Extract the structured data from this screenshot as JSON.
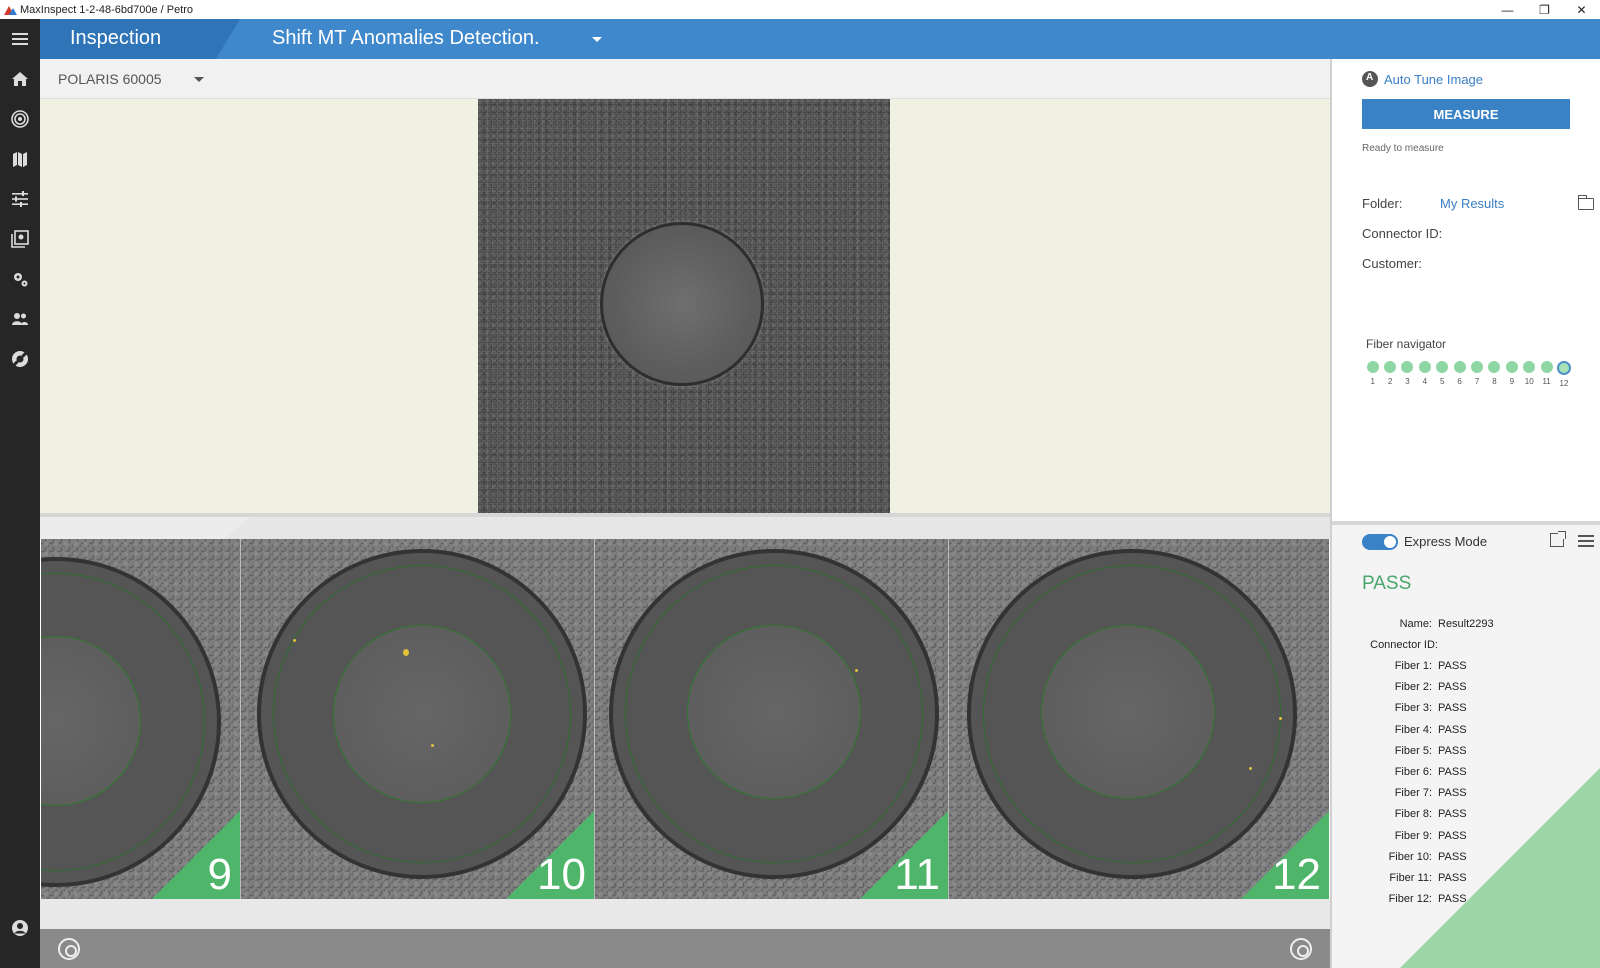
{
  "window": {
    "title": "MaxInspect 1-2-48-6bd700e / Petro",
    "minimize": "—",
    "restore": "❐",
    "close": "✕"
  },
  "header": {
    "section": "Inspection",
    "tool": "Shift MT Anomalies Detection."
  },
  "device": {
    "name": "POLARIS 60005"
  },
  "rail": {
    "icons": [
      "menu-icon",
      "home-icon",
      "target-icon",
      "map-icon",
      "sliders-icon",
      "gallery-icon",
      "settings-icon",
      "users-icon",
      "support-icon",
      "account-icon"
    ]
  },
  "panel": {
    "auto_tune": "Auto Tune Image",
    "measure": "MEASURE",
    "status": "Ready to measure",
    "folder_label": "Folder:",
    "folder_value": "My Results",
    "connector_label": "Connector ID:",
    "customer_label": "Customer:",
    "navigator_title": "Fiber navigator",
    "fibers": [
      "1",
      "2",
      "3",
      "4",
      "5",
      "6",
      "7",
      "8",
      "9",
      "10",
      "11",
      "12"
    ],
    "current_fiber": 12
  },
  "thumbnails": [
    {
      "label": "9"
    },
    {
      "label": "10"
    },
    {
      "label": "11"
    },
    {
      "label": "12"
    }
  ],
  "results": {
    "express_mode": "Express Mode",
    "status": "PASS",
    "name_label": "Name:",
    "name_value": "Result2293",
    "connector_label": "Connector ID:",
    "fibers": [
      {
        "label": "Fiber 1:",
        "value": "PASS"
      },
      {
        "label": "Fiber 2:",
        "value": "PASS"
      },
      {
        "label": "Fiber 3:",
        "value": "PASS"
      },
      {
        "label": "Fiber 4:",
        "value": "PASS"
      },
      {
        "label": "Fiber 5:",
        "value": "PASS"
      },
      {
        "label": "Fiber 6:",
        "value": "PASS"
      },
      {
        "label": "Fiber 7:",
        "value": "PASS"
      },
      {
        "label": "Fiber 8:",
        "value": "PASS"
      },
      {
        "label": "Fiber 9:",
        "value": "PASS"
      },
      {
        "label": "Fiber 10:",
        "value": "PASS"
      },
      {
        "label": "Fiber 11:",
        "value": "PASS"
      },
      {
        "label": "Fiber 12:",
        "value": "PASS"
      }
    ]
  },
  "colors": {
    "header": "#4088cc",
    "header_section": "#2f74b7",
    "rail": "#262626",
    "pass": "#4aa56c",
    "badge": "#4fb56a",
    "accent": "#3a82c6"
  }
}
